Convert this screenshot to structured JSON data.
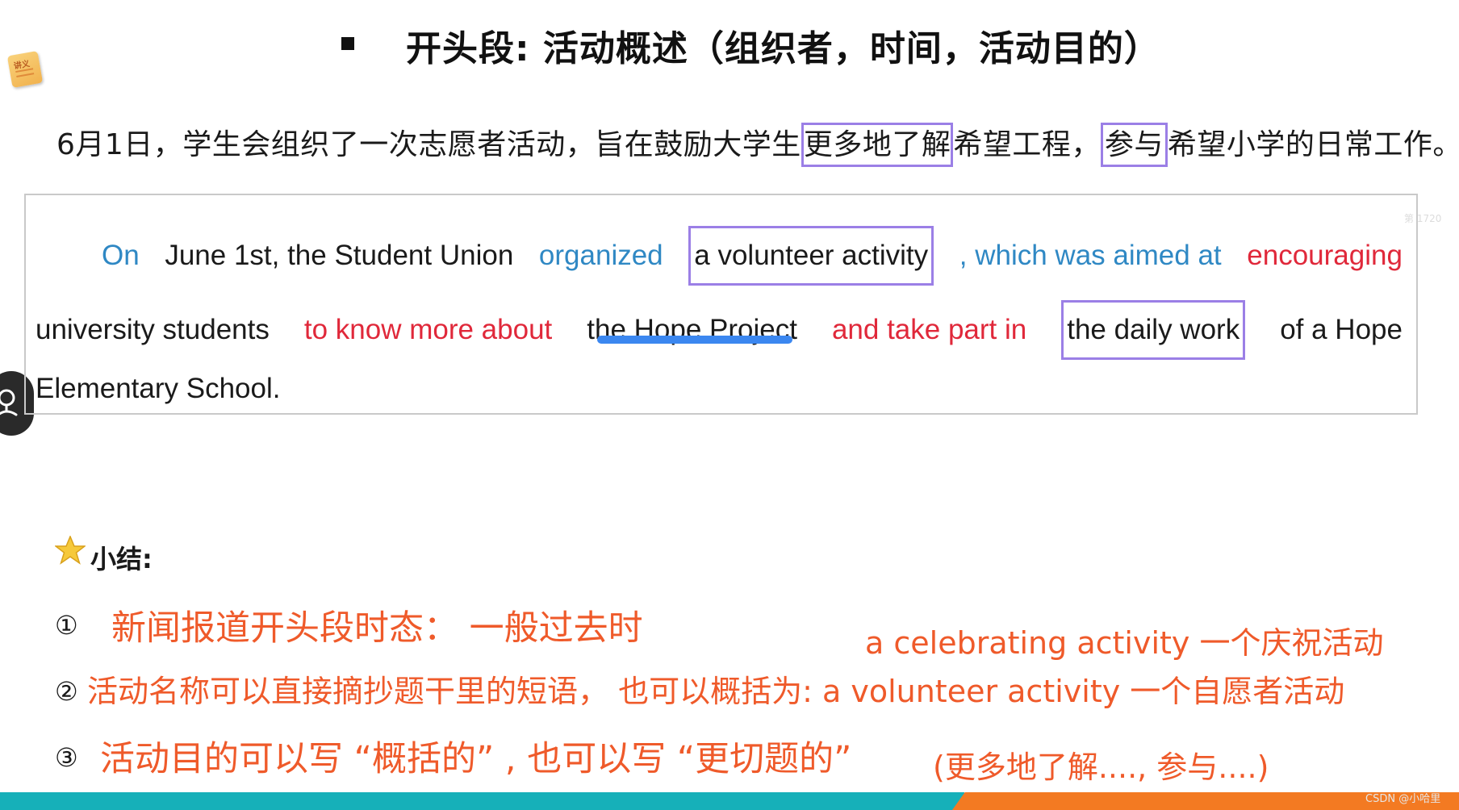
{
  "title": "开头段: 活动概述（组织者，时间，活动目的）",
  "note_icon_label": "讲义",
  "chinese_sentence": {
    "part1": "6月1日，学生会组织了一次志愿者活动，旨在鼓励大学生",
    "boxed1": "更多地了解",
    "part2": "希望工程，",
    "boxed2": "参与",
    "part3": "希望小学的日常工作。"
  },
  "english_sentence": {
    "line1": [
      {
        "text": "On",
        "color": "blue"
      },
      {
        "text": "June 1st, the Student Union",
        "color": "black"
      },
      {
        "text": "organized",
        "color": "blue"
      },
      {
        "text": "a volunteer activity",
        "color": "black",
        "framed": true
      },
      {
        "text": ", which was aimed at",
        "color": "blue"
      },
      {
        "text": "encouraging",
        "color": "red"
      }
    ],
    "line2": [
      {
        "text": "university students",
        "color": "black"
      },
      {
        "text": "to know more about",
        "color": "red"
      },
      {
        "text": "the Hope Project",
        "color": "black",
        "underlined": true
      },
      {
        "text": "and take part in",
        "color": "red"
      },
      {
        "text": "the daily work",
        "color": "black",
        "framed": true
      },
      {
        "text": "of a Hope",
        "color": "black"
      }
    ],
    "line3": "Elementary School."
  },
  "watermark_text": "第 1720",
  "summary": {
    "heading": "小结:",
    "item1_num": "①",
    "item1_text": "新闻报道开头段时态：  一般过去时",
    "side_note": "a celebrating  activity  一个庆祝活动",
    "item2_num": "②",
    "item2_text": "活动名称可以直接摘抄题干里的短语， 也可以概括为: a volunteer activity  一个自愿者活动",
    "item3_num": "③",
    "item3_text": "活动目的可以写 “概括的” , 也可以写 “更切题的”",
    "item3_note": "(更多地了解...., 参与....)"
  },
  "credit": "CSDN @小哈里",
  "colors": {
    "blue": "#2f88c4",
    "red": "#e0283a",
    "orange": "#ef5a2a",
    "frame": "#9b7fe6",
    "underline": "#3b87f0",
    "teal_bar": "#16b0b9",
    "orange_bar": "#f37a22"
  },
  "icons": [
    "note-icon",
    "assistant-icon",
    "star-icon"
  ]
}
